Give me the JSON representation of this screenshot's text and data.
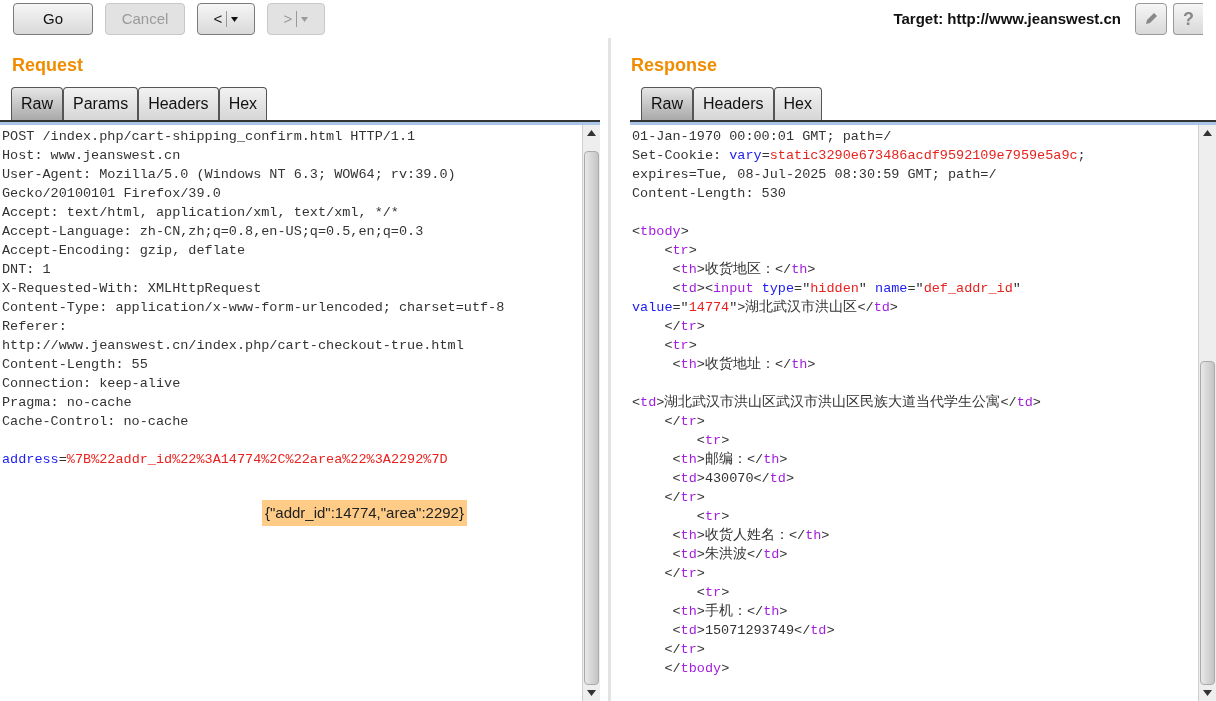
{
  "toolbar": {
    "buttons": [
      {
        "label": "Go",
        "disabled": false,
        "kind": "text"
      },
      {
        "label": "Cancel",
        "disabled": true,
        "kind": "text"
      },
      {
        "label": "<",
        "disabled": false,
        "kind": "split"
      },
      {
        "label": ">",
        "disabled": true,
        "kind": "split"
      }
    ],
    "target": "Target: http://www.jeanswest.cn",
    "help": "?"
  },
  "request": {
    "title": "Request",
    "tabs": [
      {
        "label": "Raw",
        "selected": true
      },
      {
        "label": "Params",
        "selected": false
      },
      {
        "label": "Headers",
        "selected": false
      },
      {
        "label": "Hex",
        "selected": false
      }
    ],
    "lines": [
      {
        "kind": "text",
        "segments": [
          {
            "kind": "plain",
            "text": "POST /index.php/cart-shipping_confirm.html HTTP/1.1"
          }
        ]
      },
      {
        "kind": "text",
        "segments": [
          {
            "kind": "plain",
            "text": "Host: www.jeanswest.cn"
          }
        ]
      },
      {
        "kind": "text",
        "segments": [
          {
            "kind": "plain",
            "text": "User-Agent: Mozilla/5.0 (Windows NT 6.3; WOW64; rv:39.0)"
          }
        ]
      },
      {
        "kind": "text",
        "segments": [
          {
            "kind": "plain",
            "text": "Gecko/20100101 Firefox/39.0"
          }
        ]
      },
      {
        "kind": "text",
        "segments": [
          {
            "kind": "plain",
            "text": "Accept: text/html, application/xml, text/xml, */*"
          }
        ]
      },
      {
        "kind": "text",
        "segments": [
          {
            "kind": "plain",
            "text": "Accept-Language: zh-CN,zh;q=0.8,en-US;q=0.5,en;q=0.3"
          }
        ]
      },
      {
        "kind": "text",
        "segments": [
          {
            "kind": "plain",
            "text": "Accept-Encoding: gzip, deflate"
          }
        ]
      },
      {
        "kind": "text",
        "segments": [
          {
            "kind": "plain",
            "text": "DNT: 1"
          }
        ]
      },
      {
        "kind": "text",
        "segments": [
          {
            "kind": "plain",
            "text": "X-Requested-With: XMLHttpRequest"
          }
        ]
      },
      {
        "kind": "text",
        "segments": [
          {
            "kind": "plain",
            "text": "Content-Type: application/x-www-form-urlencoded; charset=utf-8"
          }
        ]
      },
      {
        "kind": "text",
        "segments": [
          {
            "kind": "plain",
            "text": "Referer:"
          }
        ]
      },
      {
        "kind": "text",
        "segments": [
          {
            "kind": "plain",
            "text": "http://www.jeanswest.cn/index.php/cart-checkout-true.html"
          }
        ]
      },
      {
        "kind": "text",
        "segments": [
          {
            "kind": "plain",
            "text": "Content-Length: 55"
          }
        ]
      },
      {
        "kind": "text",
        "segments": [
          {
            "kind": "plain",
            "text": "Connection: keep-alive"
          }
        ]
      },
      {
        "kind": "text",
        "segments": [
          {
            "kind": "plain",
            "text": "Pragma: no-cache"
          }
        ]
      },
      {
        "kind": "text",
        "segments": [
          {
            "kind": "plain",
            "text": "Cache-Control: no-cache"
          }
        ]
      },
      {
        "kind": "blank"
      },
      {
        "kind": "text",
        "segments": [
          {
            "kind": "name",
            "text": "address"
          },
          {
            "kind": "plain",
            "text": "="
          },
          {
            "kind": "value",
            "text": "%7B%22addr_id%22%3A14774%2C%22area%22%3A2292%7D"
          }
        ]
      }
    ],
    "decoded_note": "{\"addr_id\":14774,\"area\":2292}"
  },
  "response": {
    "title": "Response",
    "tabs": [
      {
        "label": "Raw",
        "selected": true
      },
      {
        "label": "Headers",
        "selected": false
      },
      {
        "label": "Hex",
        "selected": false
      }
    ],
    "lines": [
      {
        "kind": "text",
        "segments": [
          {
            "kind": "plain",
            "text": "01-Jan-1970 00:00:01 GMT; path=/"
          }
        ]
      },
      {
        "kind": "text",
        "segments": [
          {
            "kind": "plain",
            "text": "Set-Cookie: "
          },
          {
            "kind": "name",
            "text": "vary"
          },
          {
            "kind": "plain",
            "text": "="
          },
          {
            "kind": "value",
            "text": "static3290e673486acdf9592109e7959e5a9c"
          },
          {
            "kind": "plain",
            "text": ";"
          }
        ]
      },
      {
        "kind": "text",
        "segments": [
          {
            "kind": "plain",
            "text": "expires=Tue, 08-Jul-2025 08:30:59 GMT; path=/"
          }
        ]
      },
      {
        "kind": "text",
        "segments": [
          {
            "kind": "plain",
            "text": "Content-Length: 530"
          }
        ]
      },
      {
        "kind": "blank"
      },
      {
        "kind": "text",
        "segments": [
          {
            "kind": "plain",
            "text": "<"
          },
          {
            "kind": "tag",
            "text": "tbody"
          },
          {
            "kind": "plain",
            "text": ">"
          }
        ]
      },
      {
        "kind": "text",
        "segments": [
          {
            "kind": "plain",
            "text": "    <"
          },
          {
            "kind": "tag",
            "text": "tr"
          },
          {
            "kind": "plain",
            "text": ">"
          }
        ]
      },
      {
        "kind": "text",
        "segments": [
          {
            "kind": "plain",
            "text": "     <"
          },
          {
            "kind": "tag",
            "text": "th"
          },
          {
            "kind": "plain",
            "text": ">收货地区：</"
          },
          {
            "kind": "tag",
            "text": "th"
          },
          {
            "kind": "plain",
            "text": ">"
          }
        ]
      },
      {
        "kind": "text",
        "segments": [
          {
            "kind": "plain",
            "text": "     <"
          },
          {
            "kind": "tag",
            "text": "td"
          },
          {
            "kind": "plain",
            "text": "><"
          },
          {
            "kind": "tag",
            "text": "input"
          },
          {
            "kind": "name",
            "text": "type",
            "space_before": true
          },
          {
            "kind": "plain",
            "text": "=\""
          },
          {
            "kind": "value",
            "text": "hidden"
          },
          {
            "kind": "plain",
            "text": "\" "
          },
          {
            "kind": "name",
            "text": "name"
          },
          {
            "kind": "plain",
            "text": "=\""
          },
          {
            "kind": "value",
            "text": "def_addr_id"
          },
          {
            "kind": "plain",
            "text": "\""
          }
        ]
      },
      {
        "kind": "text",
        "segments": [
          {
            "kind": "name",
            "text": "value"
          },
          {
            "kind": "plain",
            "text": "=\""
          },
          {
            "kind": "value",
            "text": "14774"
          },
          {
            "kind": "plain",
            "text": "\">湖北武汉市洪山区</"
          },
          {
            "kind": "tag",
            "text": "td"
          },
          {
            "kind": "plain",
            "text": ">"
          }
        ]
      },
      {
        "kind": "text",
        "segments": [
          {
            "kind": "plain",
            "text": "    </"
          },
          {
            "kind": "tag",
            "text": "tr"
          },
          {
            "kind": "plain",
            "text": ">"
          }
        ]
      },
      {
        "kind": "text",
        "segments": [
          {
            "kind": "plain",
            "text": "    <"
          },
          {
            "kind": "tag",
            "text": "tr"
          },
          {
            "kind": "plain",
            "text": ">"
          }
        ]
      },
      {
        "kind": "text",
        "segments": [
          {
            "kind": "plain",
            "text": "     <"
          },
          {
            "kind": "tag",
            "text": "th"
          },
          {
            "kind": "plain",
            "text": ">收货地址：</"
          },
          {
            "kind": "tag",
            "text": "th"
          },
          {
            "kind": "plain",
            "text": ">"
          }
        ]
      },
      {
        "kind": "blank"
      },
      {
        "kind": "text",
        "segments": [
          {
            "kind": "plain",
            "text": "<"
          },
          {
            "kind": "tag",
            "text": "td"
          },
          {
            "kind": "plain",
            "text": ">湖北武汉市洪山区武汉市洪山区民族大道当代学生公寓</"
          },
          {
            "kind": "tag",
            "text": "td"
          },
          {
            "kind": "plain",
            "text": ">"
          }
        ]
      },
      {
        "kind": "text",
        "segments": [
          {
            "kind": "plain",
            "text": "    </"
          },
          {
            "kind": "tag",
            "text": "tr"
          },
          {
            "kind": "plain",
            "text": ">"
          }
        ]
      },
      {
        "kind": "text",
        "segments": [
          {
            "kind": "plain",
            "text": "        <"
          },
          {
            "kind": "tag",
            "text": "tr"
          },
          {
            "kind": "plain",
            "text": ">"
          }
        ]
      },
      {
        "kind": "text",
        "segments": [
          {
            "kind": "plain",
            "text": "     <"
          },
          {
            "kind": "tag",
            "text": "th"
          },
          {
            "kind": "plain",
            "text": ">邮编：</"
          },
          {
            "kind": "tag",
            "text": "th"
          },
          {
            "kind": "plain",
            "text": ">"
          }
        ]
      },
      {
        "kind": "text",
        "segments": [
          {
            "kind": "plain",
            "text": "     <"
          },
          {
            "kind": "tag",
            "text": "td"
          },
          {
            "kind": "plain",
            "text": ">430070</"
          },
          {
            "kind": "tag",
            "text": "td"
          },
          {
            "kind": "plain",
            "text": ">"
          }
        ]
      },
      {
        "kind": "text",
        "segments": [
          {
            "kind": "plain",
            "text": "    </"
          },
          {
            "kind": "tag",
            "text": "tr"
          },
          {
            "kind": "plain",
            "text": ">"
          }
        ]
      },
      {
        "kind": "text",
        "segments": [
          {
            "kind": "plain",
            "text": "        <"
          },
          {
            "kind": "tag",
            "text": "tr"
          },
          {
            "kind": "plain",
            "text": ">"
          }
        ]
      },
      {
        "kind": "text",
        "segments": [
          {
            "kind": "plain",
            "text": "     <"
          },
          {
            "kind": "tag",
            "text": "th"
          },
          {
            "kind": "plain",
            "text": ">收货人姓名：</"
          },
          {
            "kind": "tag",
            "text": "th"
          },
          {
            "kind": "plain",
            "text": ">"
          }
        ]
      },
      {
        "kind": "text",
        "segments": [
          {
            "kind": "plain",
            "text": "     <"
          },
          {
            "kind": "tag",
            "text": "td"
          },
          {
            "kind": "plain",
            "text": ">朱洪波</"
          },
          {
            "kind": "tag",
            "text": "td"
          },
          {
            "kind": "plain",
            "text": ">"
          }
        ]
      },
      {
        "kind": "text",
        "segments": [
          {
            "kind": "plain",
            "text": "    </"
          },
          {
            "kind": "tag",
            "text": "tr"
          },
          {
            "kind": "plain",
            "text": ">"
          }
        ]
      },
      {
        "kind": "text",
        "segments": [
          {
            "kind": "plain",
            "text": "        <"
          },
          {
            "kind": "tag",
            "text": "tr"
          },
          {
            "kind": "plain",
            "text": ">"
          }
        ]
      },
      {
        "kind": "text",
        "segments": [
          {
            "kind": "plain",
            "text": "     <"
          },
          {
            "kind": "tag",
            "text": "th"
          },
          {
            "kind": "plain",
            "text": ">手机：</"
          },
          {
            "kind": "tag",
            "text": "th"
          },
          {
            "kind": "plain",
            "text": ">"
          }
        ]
      },
      {
        "kind": "text",
        "segments": [
          {
            "kind": "plain",
            "text": "     <"
          },
          {
            "kind": "tag",
            "text": "td"
          },
          {
            "kind": "plain",
            "text": ">15071293749</"
          },
          {
            "kind": "tag",
            "text": "td"
          },
          {
            "kind": "plain",
            "text": ">"
          }
        ]
      },
      {
        "kind": "text",
        "segments": [
          {
            "kind": "plain",
            "text": "    </"
          },
          {
            "kind": "tag",
            "text": "tr"
          },
          {
            "kind": "plain",
            "text": ">"
          }
        ]
      },
      {
        "kind": "text",
        "segments": [
          {
            "kind": "plain",
            "text": "    </"
          },
          {
            "kind": "tag",
            "text": "tbody"
          },
          {
            "kind": "plain",
            "text": ">"
          }
        ]
      }
    ]
  }
}
